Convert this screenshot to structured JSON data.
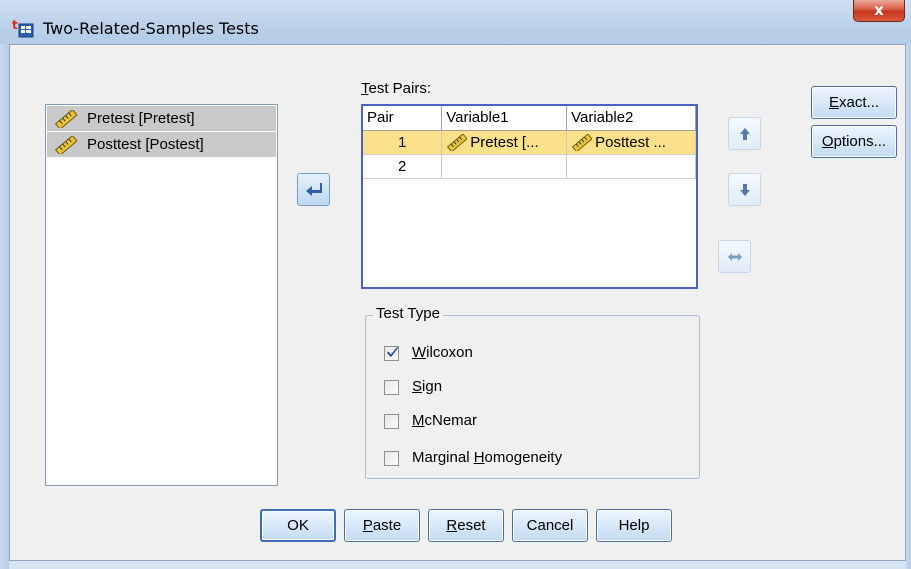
{
  "window": {
    "title": "Two-Related-Samples Tests",
    "close_glyph": "x"
  },
  "source_list": {
    "items": [
      {
        "label": "Pretest [Pretest]",
        "icon": "scale-ruler-icon"
      },
      {
        "label": "Posttest [Postest]",
        "icon": "scale-ruler-icon"
      }
    ]
  },
  "test_pairs": {
    "label_accel": "T",
    "label_rest": "est Pairs:",
    "columns": [
      "Pair",
      "Variable1",
      "Variable2"
    ],
    "rows": [
      {
        "pair": "1",
        "var1": "Pretest [...",
        "var2": "Posttest ...",
        "selected": true
      },
      {
        "pair": "2",
        "var1": "",
        "var2": "",
        "selected": false
      }
    ]
  },
  "side_buttons": {
    "exact_accel": "E",
    "exact_rest": "xact...",
    "options_accel": "O",
    "options_rest": "ptions..."
  },
  "test_type": {
    "label": "Test Type",
    "options": [
      {
        "pre": "",
        "accel": "W",
        "post": "ilcoxon",
        "checked": true
      },
      {
        "pre": "",
        "accel": "S",
        "post": "ign",
        "checked": false
      },
      {
        "pre": "",
        "accel": "M",
        "post": "cNemar",
        "checked": false
      },
      {
        "pre": "Marginal ",
        "accel": "H",
        "post": "omogeneity",
        "checked": false
      }
    ]
  },
  "footer": {
    "ok": "OK",
    "paste_accel": "P",
    "paste_rest": "aste",
    "reset_accel": "R",
    "reset_rest": "eset",
    "cancel": "Cancel",
    "help": "Help"
  },
  "colors": {
    "selected_row": "#fbe08a",
    "selected_list_item": "#c9c9c9",
    "close_button": "#c7341c",
    "table_border": "#4a62c7"
  }
}
